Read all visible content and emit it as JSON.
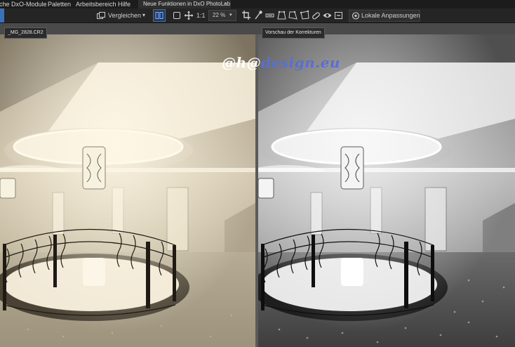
{
  "menu": {
    "items": [
      "che DxO-Module",
      "Paletten",
      "Arbeitsbereich",
      "Hilfe"
    ],
    "active_tab": "Neue Funktionen in DxO PhotoLab",
    "tab_close": "×"
  },
  "toolbar": {
    "compare_label": "Vergleichen",
    "compare_dropdown": "▾",
    "one_to_one": "1:1",
    "zoom_value": "22 %",
    "zoom_caret": "▾",
    "local_adjustments_label": "Lokale Anpassungen"
  },
  "viewer": {
    "left_label": "_MG_2828.CR2",
    "right_label": "Vorschau der Korrekturen",
    "watermark_prefix": "@h@",
    "watermark_suffix": "design.eu"
  },
  "colors": {
    "accent": "#3d6fb0",
    "sepia_light": "#e9dfc9",
    "sepia_dark": "#4a4234",
    "gray_light": "#dcdcdc",
    "gray_dark": "#2a2a2a"
  }
}
